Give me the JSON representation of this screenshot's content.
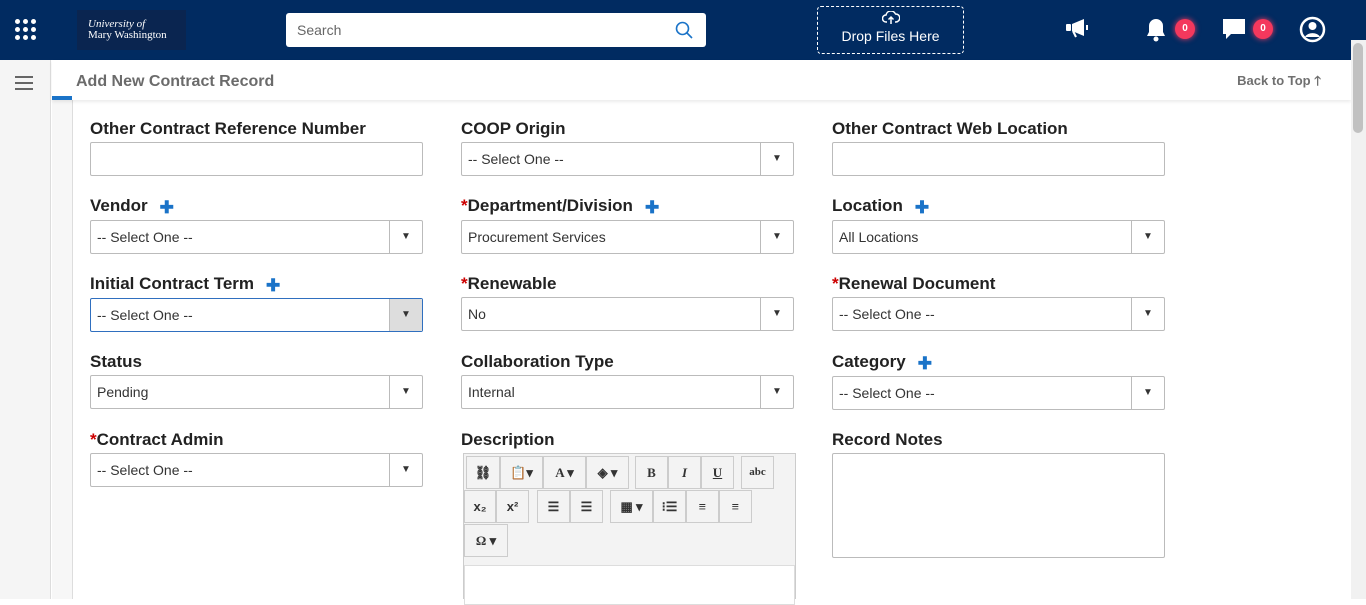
{
  "header": {
    "logo_line1": "University of",
    "logo_line2": "Mary Washington",
    "search_placeholder": "Search",
    "drop_label": "Drop Files Here",
    "notifications_count": "0",
    "messages_count": "0"
  },
  "page": {
    "title": "Add New Contract Record",
    "back_to_top": "Back to Top"
  },
  "fields": {
    "other_ref": {
      "label": "Other Contract Reference Number",
      "value": ""
    },
    "coop": {
      "label": "COOP Origin",
      "value": "-- Select One --"
    },
    "web": {
      "label": "Other Contract Web Location",
      "value": ""
    },
    "vendor": {
      "label": "Vendor",
      "value": "-- Select One --"
    },
    "dept": {
      "label": "Department/Division",
      "value": "Procurement Services"
    },
    "location": {
      "label": "Location",
      "value": "All Locations"
    },
    "term": {
      "label": "Initial Contract Term",
      "value": "-- Select One --"
    },
    "renewable": {
      "label": "Renewable",
      "value": "No"
    },
    "renewal_doc": {
      "label": "Renewal Document",
      "value": "-- Select One --"
    },
    "status": {
      "label": "Status",
      "value": "Pending"
    },
    "collab": {
      "label": "Collaboration Type",
      "value": "Internal"
    },
    "category": {
      "label": "Category",
      "value": "-- Select One --"
    },
    "admin": {
      "label": "Contract Admin",
      "value": "-- Select One --"
    },
    "description": {
      "label": "Description"
    },
    "notes": {
      "label": "Record Notes"
    }
  },
  "required_mark": "*",
  "editor_toolbar": {
    "bold": "B",
    "italic": "I",
    "underline": "U",
    "strike": "abc",
    "font": "A",
    "sub": "x₂",
    "sup": "x²",
    "special": "Ω"
  }
}
